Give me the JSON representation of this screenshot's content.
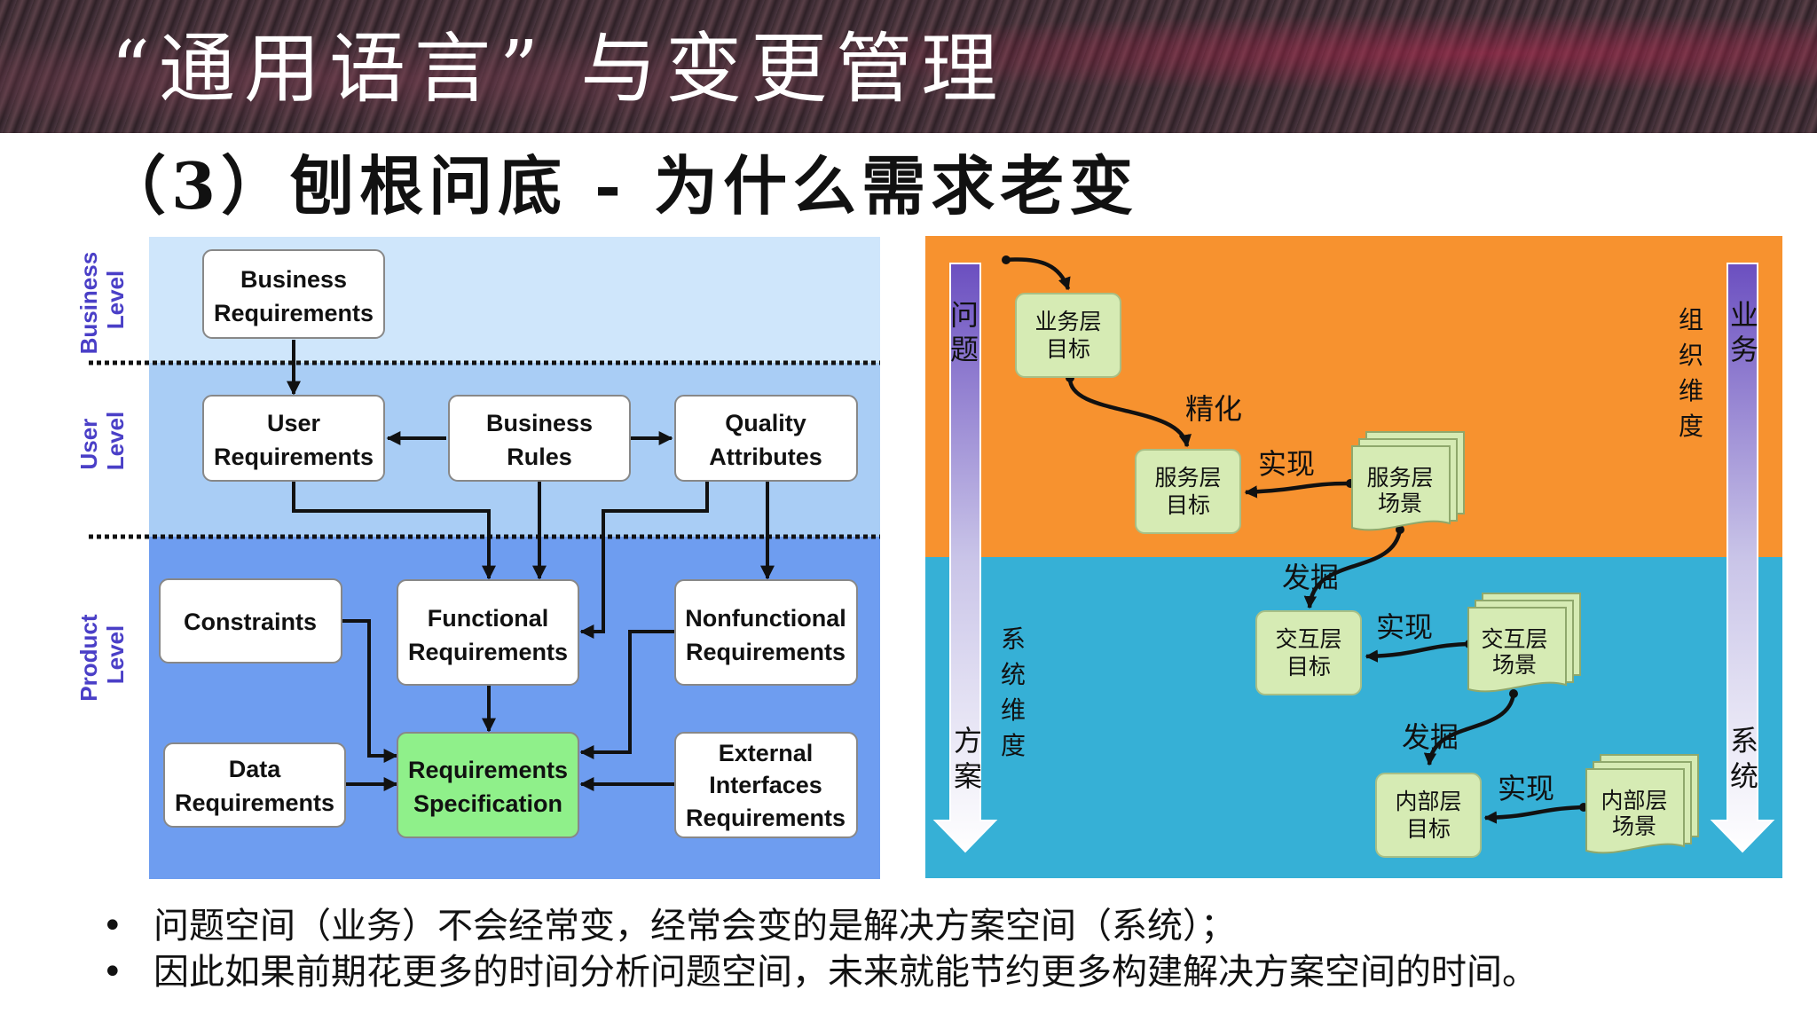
{
  "header": {
    "title": "“通用语言” 与变更管理"
  },
  "subtitle": "（3）刨根问底 - 为什么需求老变",
  "left_diagram": {
    "levels": {
      "business": "Business Level",
      "user": "User Level",
      "product": "Product Level"
    },
    "boxes": {
      "business_requirements": [
        "Business",
        "Requirements"
      ],
      "user_requirements": [
        "User",
        "Requirements"
      ],
      "business_rules": [
        "Business",
        "Rules"
      ],
      "quality_attributes": [
        "Quality",
        "Attributes"
      ],
      "constraints": [
        "Constraints"
      ],
      "functional_requirements": [
        "Functional",
        "Requirements"
      ],
      "nonfunctional_requirements": [
        "Nonfunctional",
        "Requirements"
      ],
      "data_requirements": [
        "Data",
        "Requirements"
      ],
      "requirements_specification": [
        "Requirements",
        "Specification"
      ],
      "external_interfaces": [
        "External",
        "Interfaces",
        "Requirements"
      ]
    },
    "colors": {
      "top_band": "#cfe6fb",
      "mid_band": "#a9cdf5",
      "bottom_band": "#6e9df0",
      "spec_box": "#8ff08a",
      "level_text": "#4a3fc7"
    }
  },
  "right_diagram": {
    "left_axis": {
      "top": [
        "问",
        "题"
      ],
      "bottom": [
        "方",
        "案"
      ]
    },
    "right_axis": {
      "top": [
        "业",
        "务"
      ],
      "bottom": [
        "系",
        "统"
      ]
    },
    "org_dimension": [
      "组",
      "织",
      "维",
      "度"
    ],
    "sys_dimension": [
      "系",
      "统",
      "维",
      "度"
    ],
    "boxes": {
      "biz_goal": [
        "业务层",
        "目标"
      ],
      "service_goal": [
        "服务层",
        "目标"
      ],
      "service_scene": [
        "服务层",
        "场景"
      ],
      "interact_goal": [
        "交互层",
        "目标"
      ],
      "interact_scene": [
        "交互层",
        "场景"
      ],
      "internal_goal": [
        "内部层",
        "目标"
      ],
      "internal_scene": [
        "内部层",
        "场景"
      ]
    },
    "arrow_labels": {
      "refine": "精化",
      "realize_1": "实现",
      "discover_1": "发掘",
      "realize_2": "实现",
      "discover_2": "发掘",
      "realize_3": "实现"
    },
    "colors": {
      "top_bg": "#f7922f",
      "bottom_bg": "#36b0d6",
      "box": "#d6ebb4"
    }
  },
  "bullets": [
    "问题空间（业务）不会经常变，经常会变的是解决方案空间（系统）；",
    "因此如果前期花更多的时间分析问题空间，未来就能节约更多构建解决方案空间的时间。"
  ]
}
